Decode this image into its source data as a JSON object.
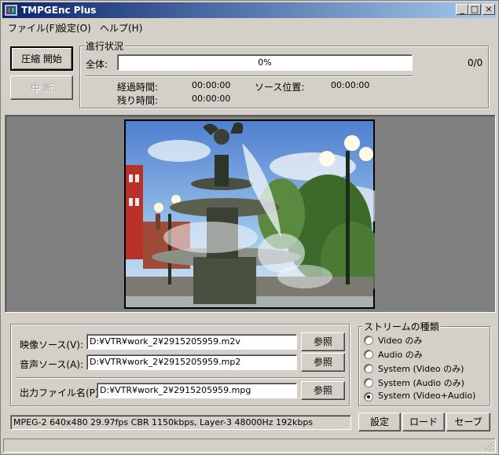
{
  "window": {
    "title": "TMPGEnc Plus"
  },
  "menu": {
    "file": "ファイル(F)",
    "settings": "設定(O)",
    "help": "ヘルプ(H)"
  },
  "toolbar": {
    "start": "圧縮 開始",
    "stop": "中 断"
  },
  "progress": {
    "group_label": "進行状況",
    "total_label": "全体:",
    "percent_text": "0%",
    "percent_value": 0,
    "count": "0/0",
    "elapsed_label": "経過時間:",
    "elapsed_value": "00:00:00",
    "remaining_label": "残り時間:",
    "remaining_value": "00:00:00",
    "source_pos_label": "ソース位置:",
    "source_pos_value": "00:00:00"
  },
  "sources": {
    "video_label": "映像ソース(V):",
    "video_value": "D:¥VTR¥work_2¥2915205959.m2v",
    "audio_label": "音声ソース(A):",
    "audio_value": "D:¥VTR¥work_2¥2915205959.mp2",
    "output_label": "出力ファイル名(P):",
    "output_value": "D:¥VTR¥work_2¥2915205959.mpg",
    "browse": "参照"
  },
  "stream_type": {
    "label": "ストリームの種類",
    "options": [
      "Video のみ",
      "Audio のみ",
      "System (Video のみ)",
      "System (Audio のみ)",
      "System (Video+Audio)"
    ],
    "selected_index": 4
  },
  "status": {
    "info": "MPEG-2 640x480 29.97fps CBR 1150kbps,  Layer-3 48000Hz 192kbps"
  },
  "buttons": {
    "settings": "設定",
    "load": "ロード",
    "save": "セーブ"
  },
  "colors": {
    "title_start": "#0a246a",
    "title_end": "#a6caf0",
    "face": "#d4d0c8",
    "preview_bg": "#808080"
  }
}
